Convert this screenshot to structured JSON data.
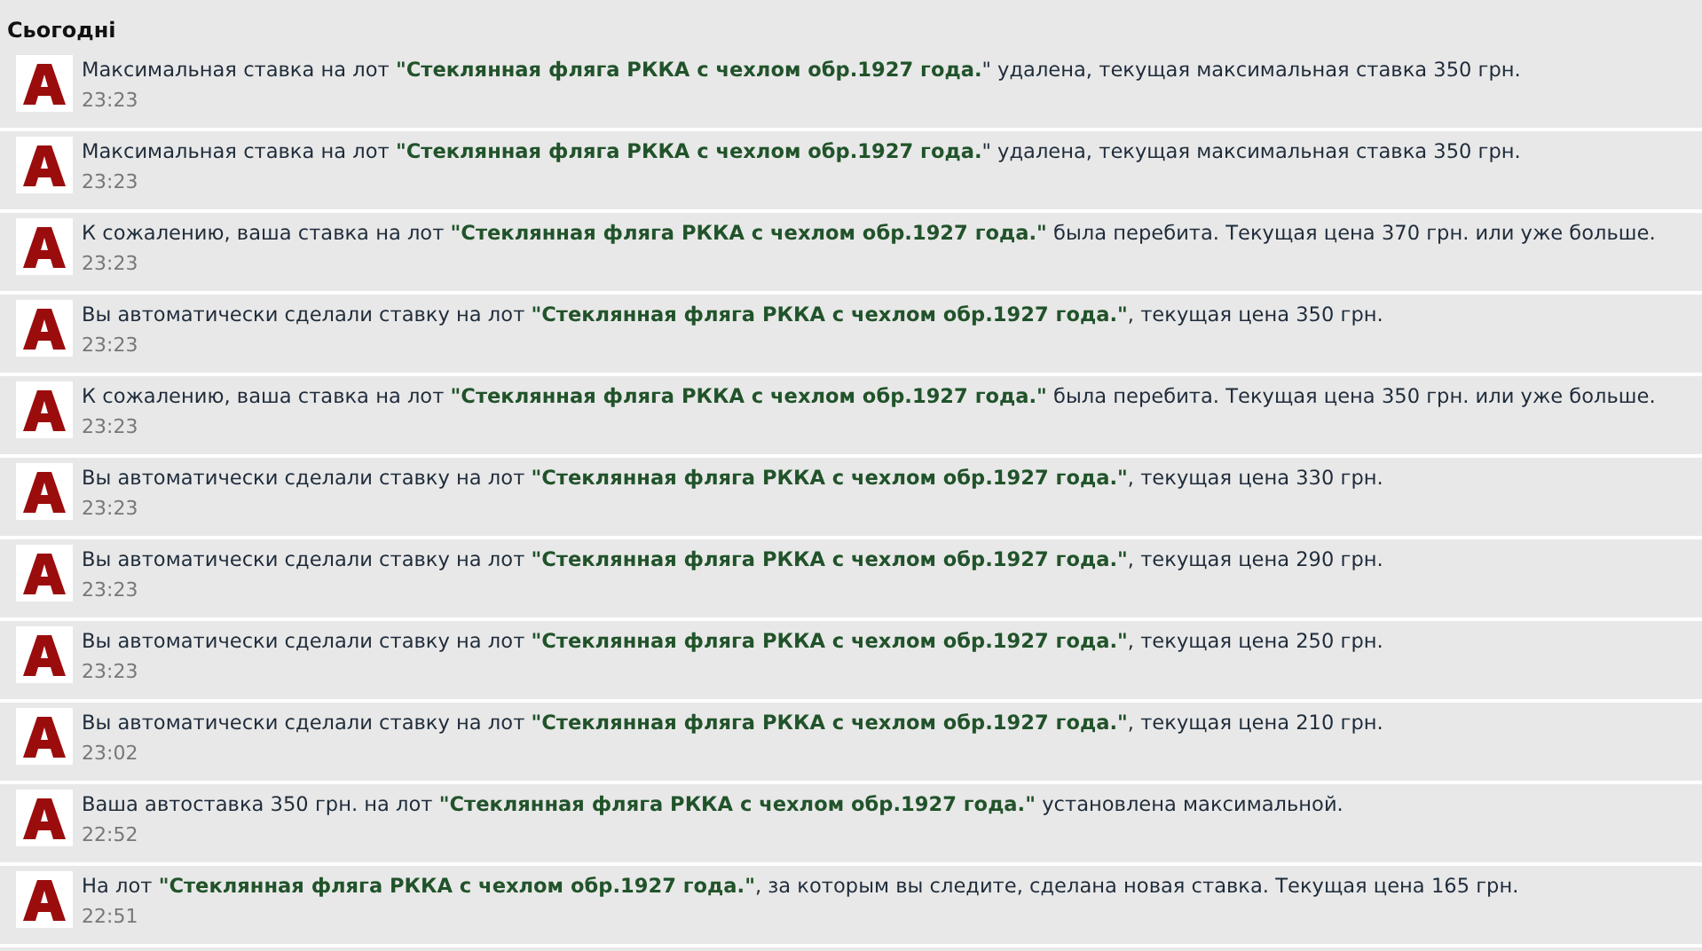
{
  "heading": "Сьогодні",
  "notifications": [
    {
      "before": "Максимальная ставка на лот ",
      "link": "\"Стеклянная фляга РККА с чехлом обр.1927 года.",
      "after": "\" удалена, текущая максимальная ставка 350 грн.",
      "time": "23:23"
    },
    {
      "before": "Максимальная ставка на лот ",
      "link": "\"Стеклянная фляга РККА с чехлом обр.1927 года.",
      "after": "\" удалена, текущая максимальная ставка 350 грн.",
      "time": "23:23"
    },
    {
      "before": "К сожалению, ваша ставка на лот ",
      "link": "\"Стеклянная фляга РККА с чехлом обр.1927 года.\"",
      "after": " была перебита. Текущая цена 370 грн. или уже больше.",
      "time": "23:23"
    },
    {
      "before": "Вы автоматически сделали ставку на лот ",
      "link": "\"Стеклянная фляга РККА с чехлом обр.1927 года.\"",
      "after": ", текущая цена 350 грн.",
      "time": "23:23"
    },
    {
      "before": "К сожалению, ваша ставка на лот ",
      "link": "\"Стеклянная фляга РККА с чехлом обр.1927 года.\"",
      "after": " была перебита. Текущая цена 350 грн. или уже больше.",
      "time": "23:23"
    },
    {
      "before": "Вы автоматически сделали ставку на лот ",
      "link": "\"Стеклянная фляга РККА с чехлом обр.1927 года.\"",
      "after": ", текущая цена 330 грн.",
      "time": "23:23"
    },
    {
      "before": "Вы автоматически сделали ставку на лот ",
      "link": "\"Стеклянная фляга РККА с чехлом обр.1927 года.\"",
      "after": ", текущая цена 290 грн.",
      "time": "23:23"
    },
    {
      "before": "Вы автоматически сделали ставку на лот ",
      "link": "\"Стеклянная фляга РККА с чехлом обр.1927 года.\"",
      "after": ", текущая цена 250 грн.",
      "time": "23:23"
    },
    {
      "before": "Вы автоматически сделали ставку на лот ",
      "link": "\"Стеклянная фляга РККА с чехлом обр.1927 года.\"",
      "after": ", текущая цена 210 грн.",
      "time": "23:02"
    },
    {
      "before": "Ваша автоставка 350 грн. на лот ",
      "link": "\"Стеклянная фляга РККА с чехлом обр.1927 года.\"",
      "after": " установлена максимальной.",
      "time": "22:52"
    },
    {
      "before": "На лот ",
      "link": "\"Стеклянная фляга РККА с чехлом обр.1927 года.\"",
      "after": ", за которым вы следите, сделана новая ставка. Текущая цена 165 грн.",
      "time": "22:51"
    }
  ]
}
